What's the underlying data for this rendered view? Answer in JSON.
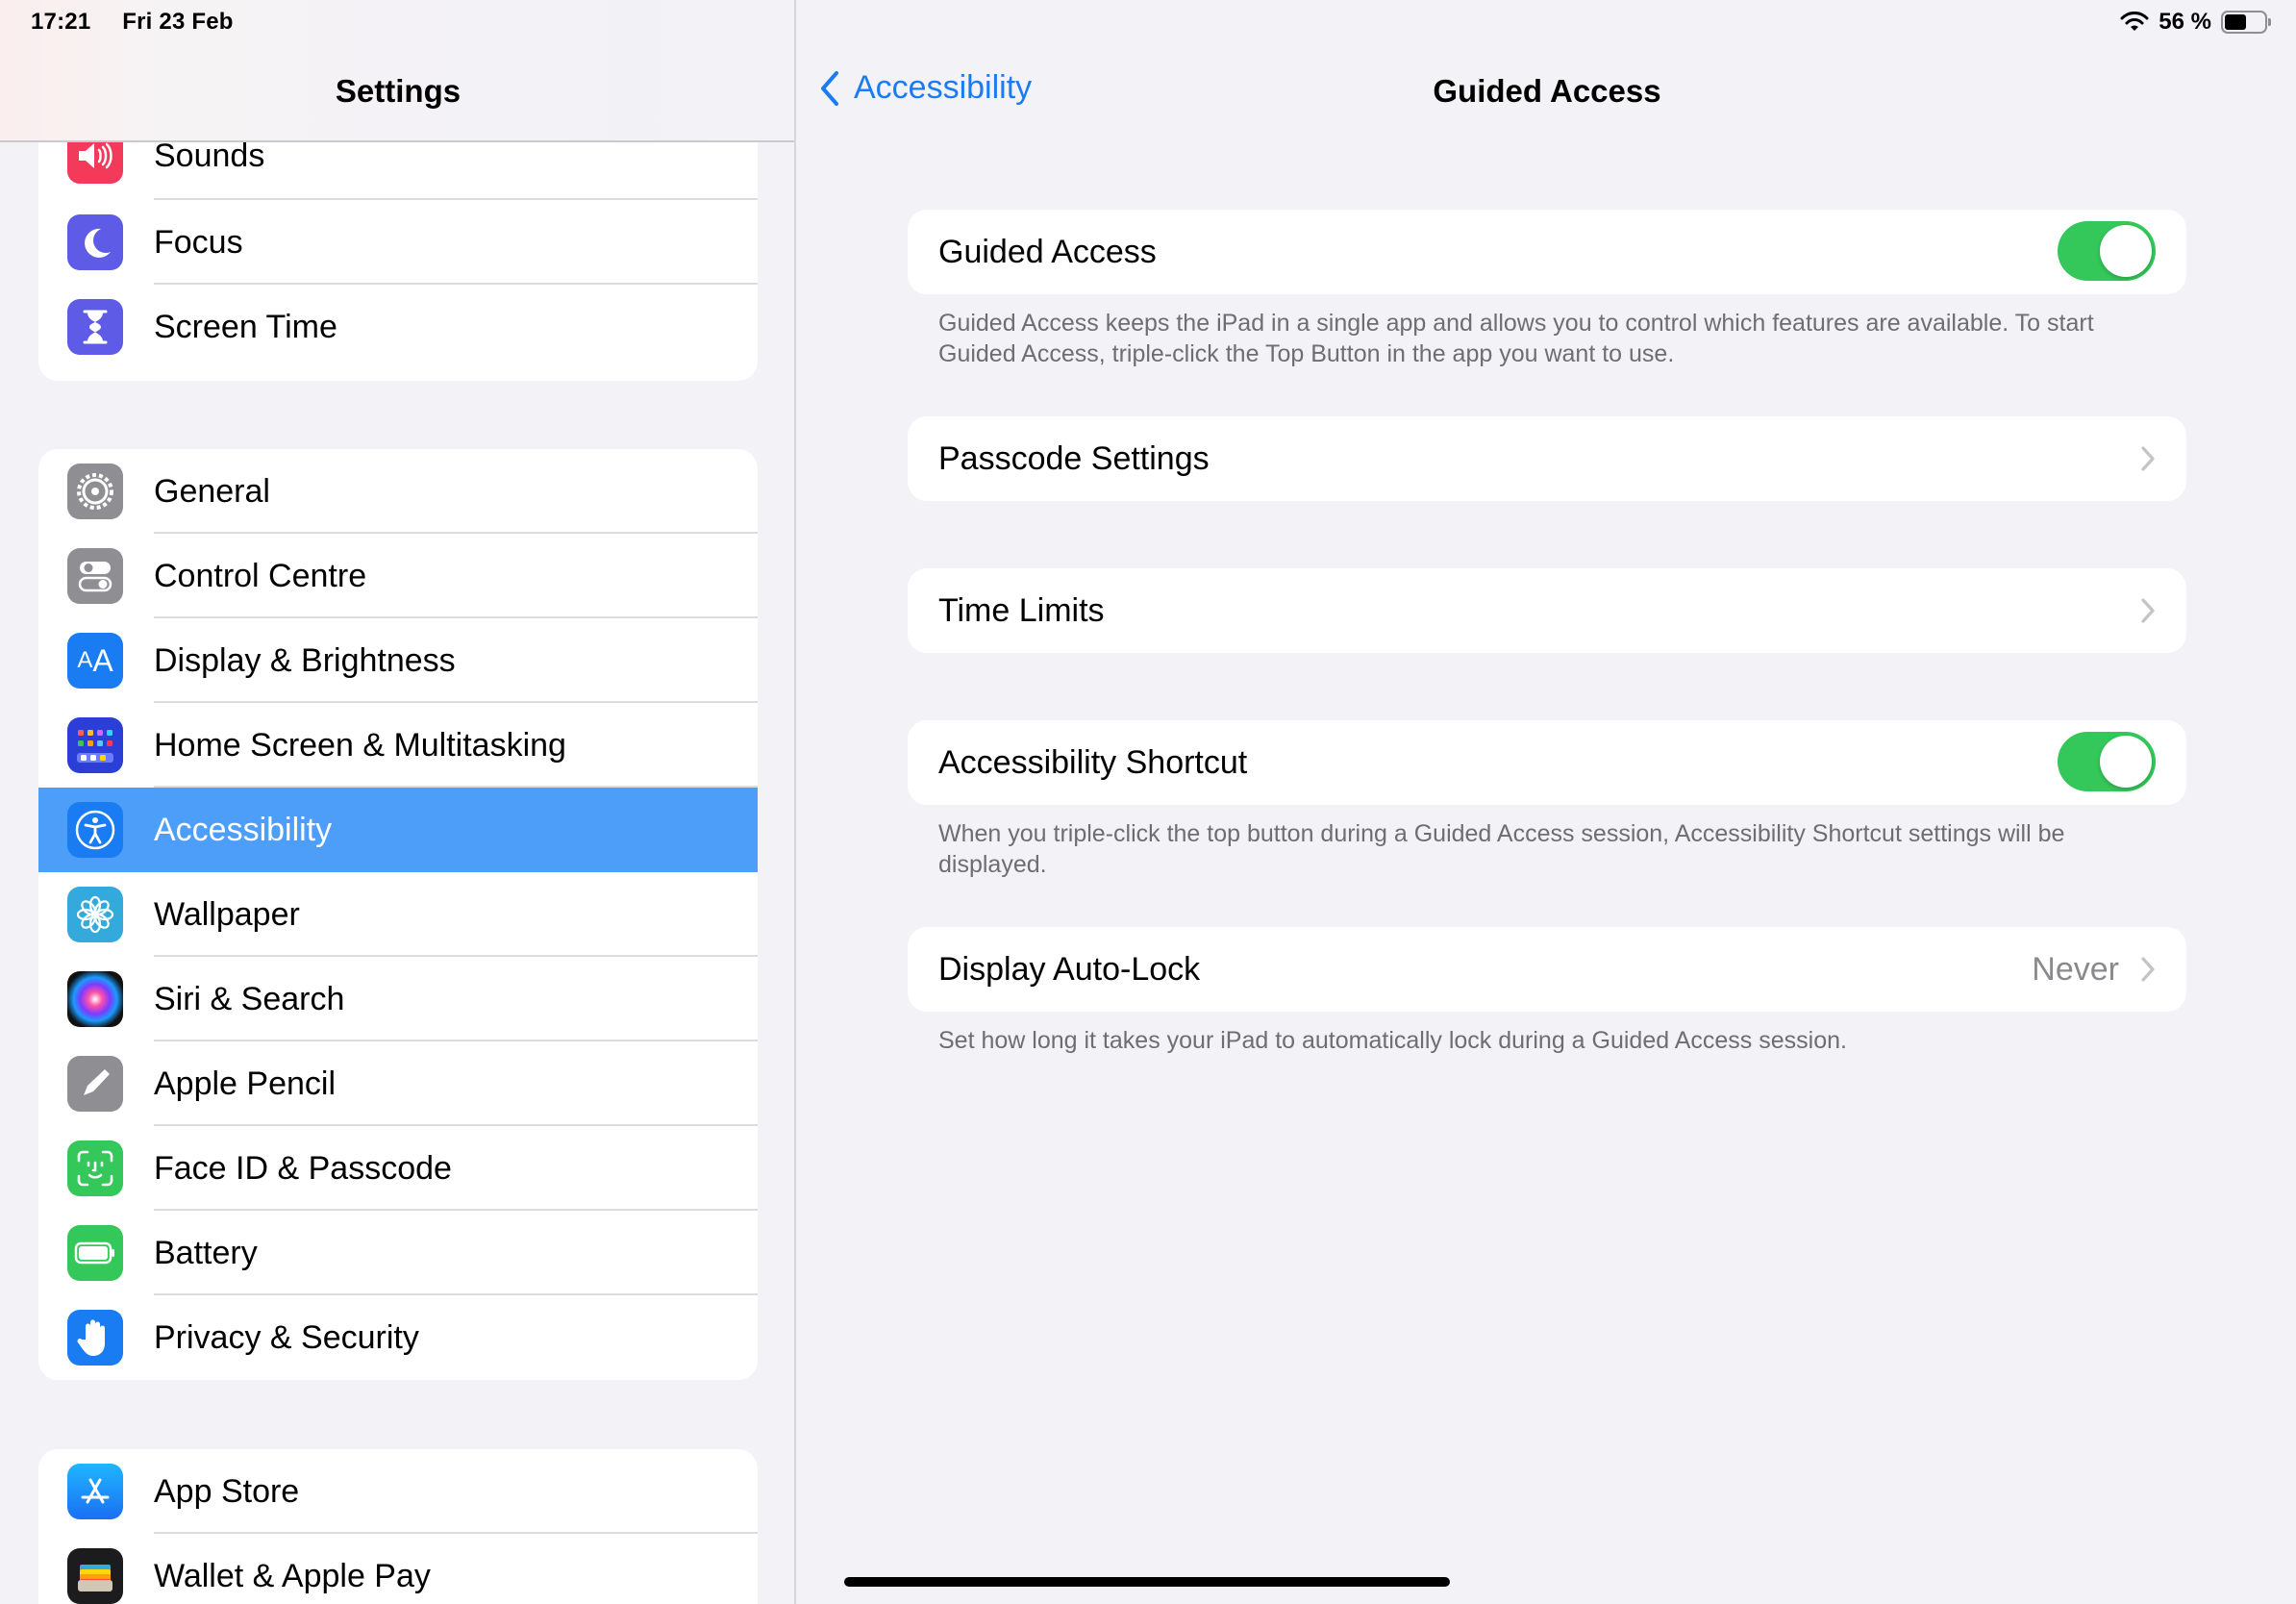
{
  "status_bar": {
    "time": "17:21",
    "date": "Fri 23 Feb",
    "battery_percent": "56 %",
    "battery_level": 0.56
  },
  "sidebar": {
    "title": "Settings",
    "groups": [
      {
        "items": [
          {
            "label": "Sounds",
            "icon": "speaker-icon",
            "color": "#f33a5a"
          },
          {
            "label": "Focus",
            "icon": "moon-icon",
            "color": "#5e5ce6"
          },
          {
            "label": "Screen Time",
            "icon": "hourglass-icon",
            "color": "#5e5ce6"
          }
        ]
      },
      {
        "items": [
          {
            "label": "General",
            "icon": "gear-icon",
            "color": "#8e8e93"
          },
          {
            "label": "Control Centre",
            "icon": "toggles-icon",
            "color": "#8e8e93"
          },
          {
            "label": "Display & Brightness",
            "icon": "text-size-icon",
            "color": "#1a7cf3"
          },
          {
            "label": "Home Screen & Multitasking",
            "icon": "app-grid-icon",
            "color": "#2b3fd6"
          },
          {
            "label": "Accessibility",
            "icon": "accessibility-icon",
            "color": "#1a7cf3",
            "selected": true
          },
          {
            "label": "Wallpaper",
            "icon": "flower-icon",
            "color": "#34aadc"
          },
          {
            "label": "Siri & Search",
            "icon": "siri-icon",
            "color": "#222"
          },
          {
            "label": "Apple Pencil",
            "icon": "pencil-icon",
            "color": "#8e8e93"
          },
          {
            "label": "Face ID & Passcode",
            "icon": "face-id-icon",
            "color": "#34c759"
          },
          {
            "label": "Battery",
            "icon": "battery-icon",
            "color": "#34c759"
          },
          {
            "label": "Privacy & Security",
            "icon": "hand-icon",
            "color": "#1a7cf3"
          }
        ]
      },
      {
        "items": [
          {
            "label": "App Store",
            "icon": "app-store-icon",
            "color": "#1a8cf7"
          },
          {
            "label": "Wallet & Apple Pay",
            "icon": "wallet-icon",
            "color": "#1c1c1e"
          }
        ]
      }
    ]
  },
  "detail": {
    "back_label": "Accessibility",
    "title": "Guided Access",
    "guided_access": {
      "label": "Guided Access",
      "on": true
    },
    "guided_access_note": "Guided Access keeps the iPad in a single app and allows you to control which features are available. To start Guided Access, triple-click the Top Button in the app you want to use.",
    "passcode_settings": "Passcode Settings",
    "time_limits": "Time Limits",
    "accessibility_shortcut": {
      "label": "Accessibility Shortcut",
      "on": true
    },
    "shortcut_note": "When you triple-click the top button during a Guided Access session, Accessibility Shortcut settings will be displayed.",
    "display_auto_lock": {
      "label": "Display Auto-Lock",
      "value": "Never"
    },
    "auto_lock_note": "Set how long it takes your iPad to automatically lock during a Guided Access session."
  },
  "colors": {
    "accent": "#1a7cf3",
    "selection": "#4d9ef8",
    "toggle_on": "#34c759"
  }
}
